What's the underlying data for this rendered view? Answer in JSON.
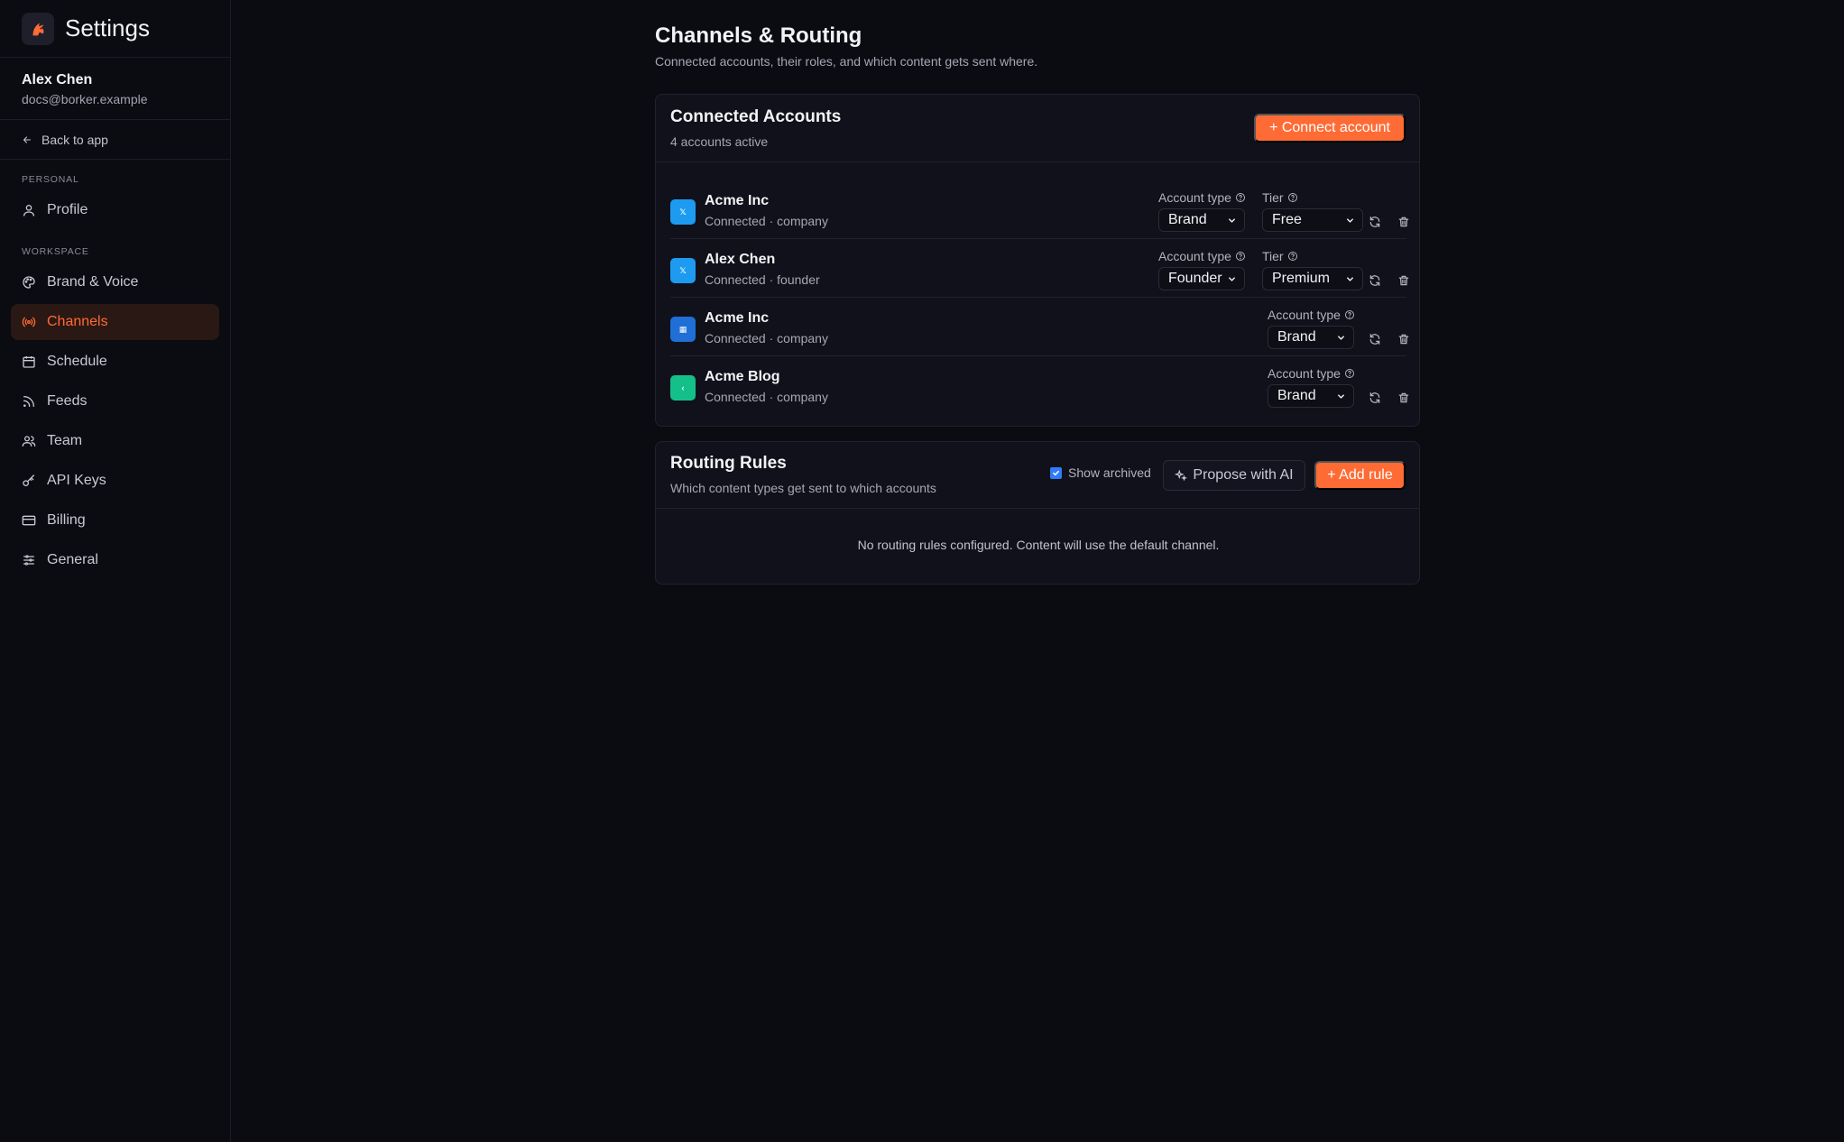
{
  "app": {
    "title": "Settings"
  },
  "user": {
    "name": "Alex Chen",
    "email": "docs@borker.example"
  },
  "nav": {
    "back_label": "Back to app",
    "personal_label": "PERSONAL",
    "workspace_label": "WORKSPACE",
    "personal_items": [
      {
        "label": "Profile",
        "icon": "user-icon"
      }
    ],
    "workspace_items": [
      {
        "label": "Brand & Voice",
        "icon": "palette-icon"
      },
      {
        "label": "Channels",
        "icon": "broadcast-icon",
        "active": true
      },
      {
        "label": "Schedule",
        "icon": "calendar-icon"
      },
      {
        "label": "Feeds",
        "icon": "rss-icon"
      },
      {
        "label": "Team",
        "icon": "users-icon"
      },
      {
        "label": "API Keys",
        "icon": "key-icon"
      },
      {
        "label": "Billing",
        "icon": "credit-card-icon"
      },
      {
        "label": "General",
        "icon": "sliders-icon"
      }
    ]
  },
  "page": {
    "title": "Channels & Routing",
    "subtitle": "Connected accounts, their roles, and which content gets sent where."
  },
  "accounts_card": {
    "title": "Connected Accounts",
    "subtitle": "4 accounts active",
    "connect_label": "+ Connect account",
    "account_type_label": "Account type",
    "tier_label": "Tier",
    "accounts": [
      {
        "name": "Acme Inc",
        "status": "Connected · company",
        "platform_icon": "x-icon",
        "icon_glyph": "𝕏",
        "icon_color": "#1d9bf0",
        "account_type": "Brand",
        "tier": "Free"
      },
      {
        "name": "Alex Chen",
        "status": "Connected · founder",
        "platform_icon": "x-icon",
        "icon_glyph": "𝕏",
        "icon_color": "#1d9bf0",
        "account_type": "Founder",
        "tier": "Premium"
      },
      {
        "name": "Acme Inc",
        "status": "Connected · company",
        "platform_icon": "linkedin-icon",
        "icon_glyph": "▦",
        "icon_color": "#1f6fd6",
        "account_type": "Brand"
      },
      {
        "name": "Acme Blog",
        "status": "Connected · company",
        "platform_icon": "blog-icon",
        "icon_glyph": "‹",
        "icon_color": "#14c08a",
        "account_type": "Brand"
      }
    ]
  },
  "routing_card": {
    "title": "Routing Rules",
    "subtitle": "Which content types get sent to which accounts",
    "show_archived_label": "Show archived",
    "show_archived_checked": true,
    "propose_label": "Propose with AI",
    "add_rule_label": "+ Add rule",
    "empty_message": "No routing rules configured. Content will use the default channel."
  },
  "colors": {
    "accent": "#ff6b35",
    "background": "#0b0b12",
    "card": "#11111b",
    "checkbox": "#2f7cf6"
  }
}
